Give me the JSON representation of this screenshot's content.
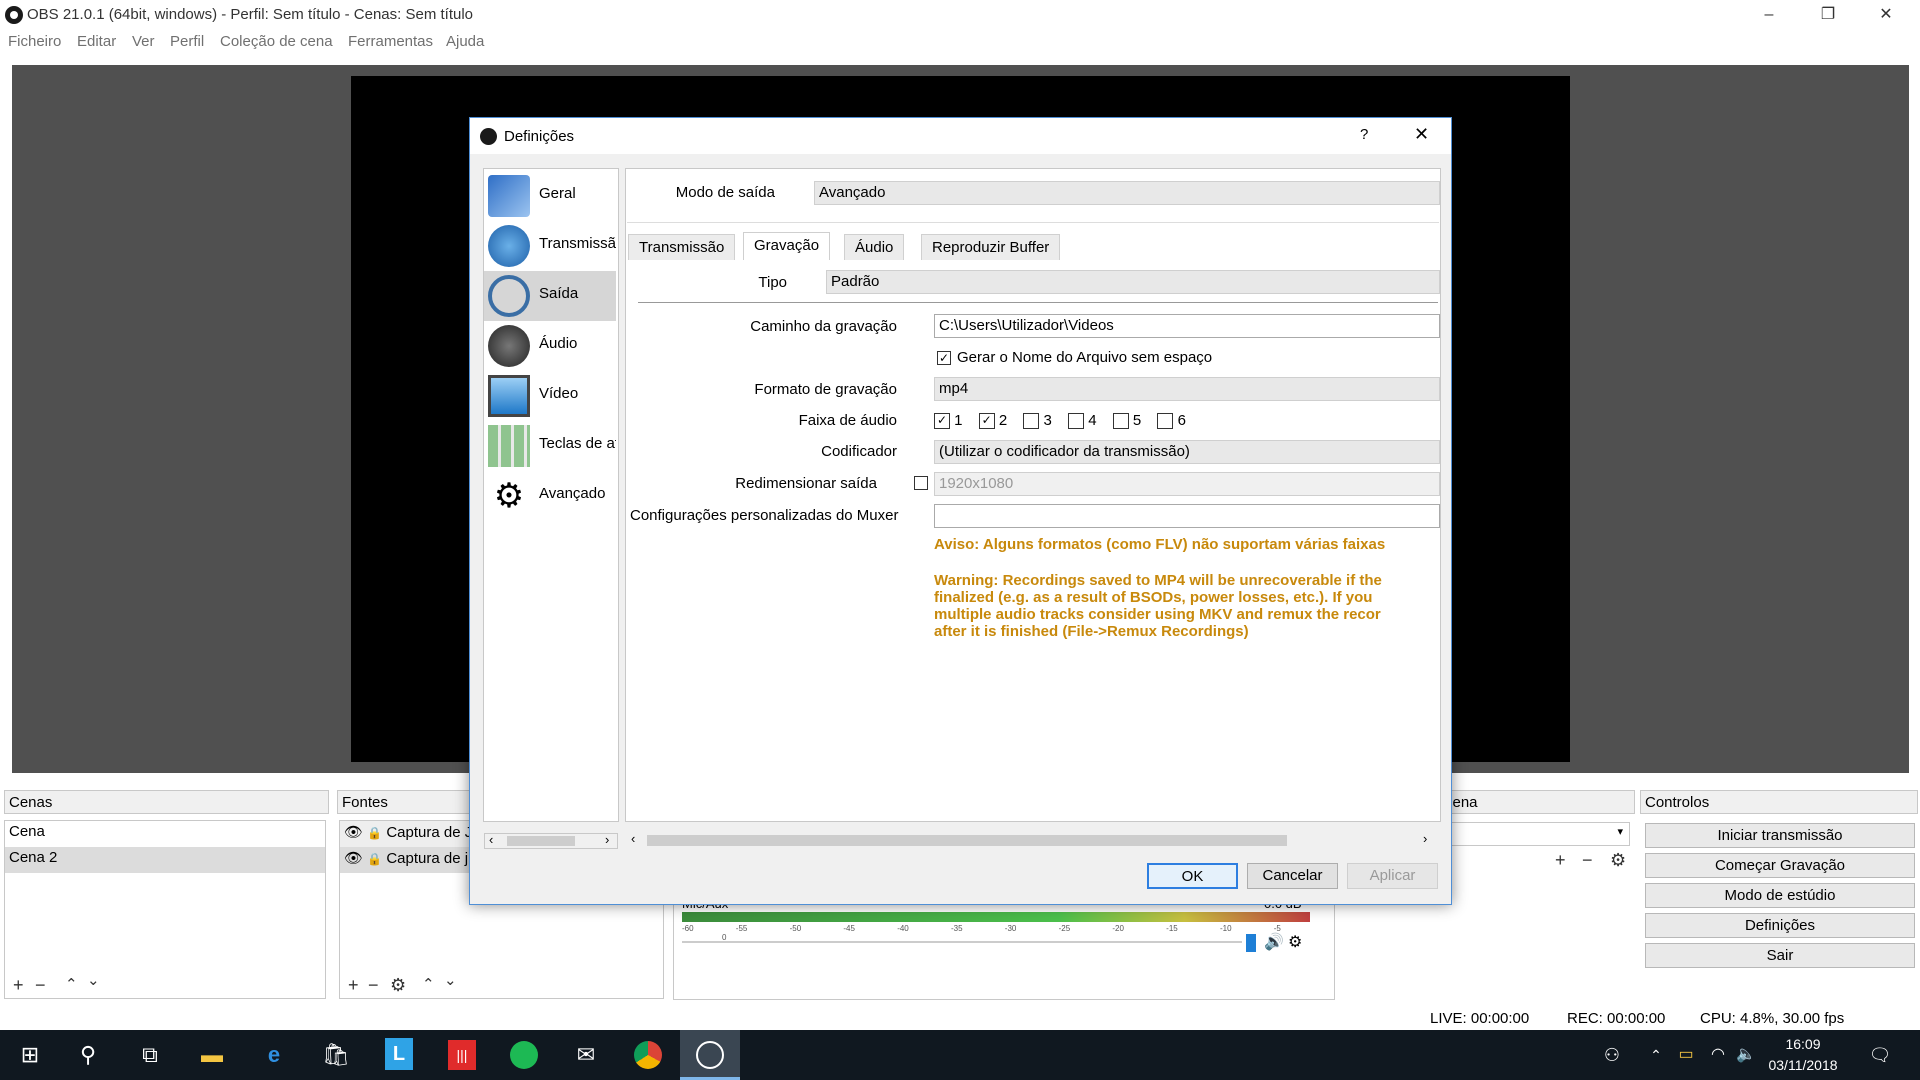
{
  "window": {
    "title": "OBS 21.0.1 (64bit, windows) - Perfil: Sem título - Cenas: Sem título",
    "minimize": "–",
    "restore": "❐",
    "close": "✕"
  },
  "menu": [
    "Ficheiro",
    "Editar",
    "Ver",
    "Perfil",
    "Coleção de cena",
    "Ferramentas",
    "Ajuda"
  ],
  "scenes": {
    "header": "Cenas",
    "items": [
      "Cena",
      "Cena 2"
    ]
  },
  "sources": {
    "header": "Fontes",
    "items": [
      "Captura de J",
      "Captura de j"
    ]
  },
  "transitions": {
    "header_fragment": "cena"
  },
  "mixer": {
    "label": "Mic/Aux",
    "db": "0.0 dB",
    "ticks": [
      "-60",
      "-55",
      "-50",
      "-45",
      "-40",
      "-35",
      "-30",
      "-25",
      "-20",
      "-15",
      "-10",
      "-5",
      "0"
    ]
  },
  "controls": {
    "header": "Controlos",
    "buttons": [
      "Iniciar transmissão",
      "Começar Gravação",
      "Modo de estúdio",
      "Definições",
      "Sair"
    ]
  },
  "status": {
    "live": "LIVE: 00:00:00",
    "rec": "REC: 00:00:00",
    "cpu": "CPU: 4.8%, 30.00 fps"
  },
  "taskbar": {
    "time": "16:09",
    "date": "03/11/2018"
  },
  "dialog": {
    "title": "Definições",
    "help": "?",
    "close": "✕",
    "sidebar": [
      "Geral",
      "Transmissão",
      "Saída",
      "Áudio",
      "Vídeo",
      "Teclas de atalho",
      "Avançado"
    ],
    "output_mode_label": "Modo de saída",
    "output_mode_value": "Avançado",
    "tabs": [
      "Transmissão",
      "Gravação",
      "Áudio",
      "Reproduzir Buffer"
    ],
    "type_label": "Tipo",
    "type_value": "Padrão",
    "path_label": "Caminho da gravação",
    "path_value": "C:\\Users\\Utilizador\\Videos",
    "nospace_label": "Gerar o Nome do Arquivo sem espaço",
    "format_label": "Formato de gravação",
    "format_value": "mp4",
    "tracks_label": "Faixa de áudio",
    "tracks": [
      {
        "n": "1",
        "checked": true
      },
      {
        "n": "2",
        "checked": true
      },
      {
        "n": "3",
        "checked": false
      },
      {
        "n": "4",
        "checked": false
      },
      {
        "n": "5",
        "checked": false
      },
      {
        "n": "6",
        "checked": false
      }
    ],
    "encoder_label": "Codificador",
    "encoder_value": "(Utilizar o codificador da transmissão)",
    "rescale_label": "Redimensionar saída",
    "rescale_value": "1920x1080",
    "muxer_label": "Configurações personalizadas do Muxer",
    "muxer_value": "",
    "warning1": "Aviso: Alguns formatos (como FLV) não suportam várias faixas",
    "warning2": [
      "Warning: Recordings saved to MP4 will be unrecoverable if the",
      "finalized (e.g. as a result of BSODs, power losses, etc.). If you",
      "multiple audio tracks consider using MKV and remux the recor",
      "after it is finished (File->Remux Recordings)"
    ],
    "ok": "OK",
    "cancel": "Cancelar",
    "apply": "Aplicar"
  }
}
